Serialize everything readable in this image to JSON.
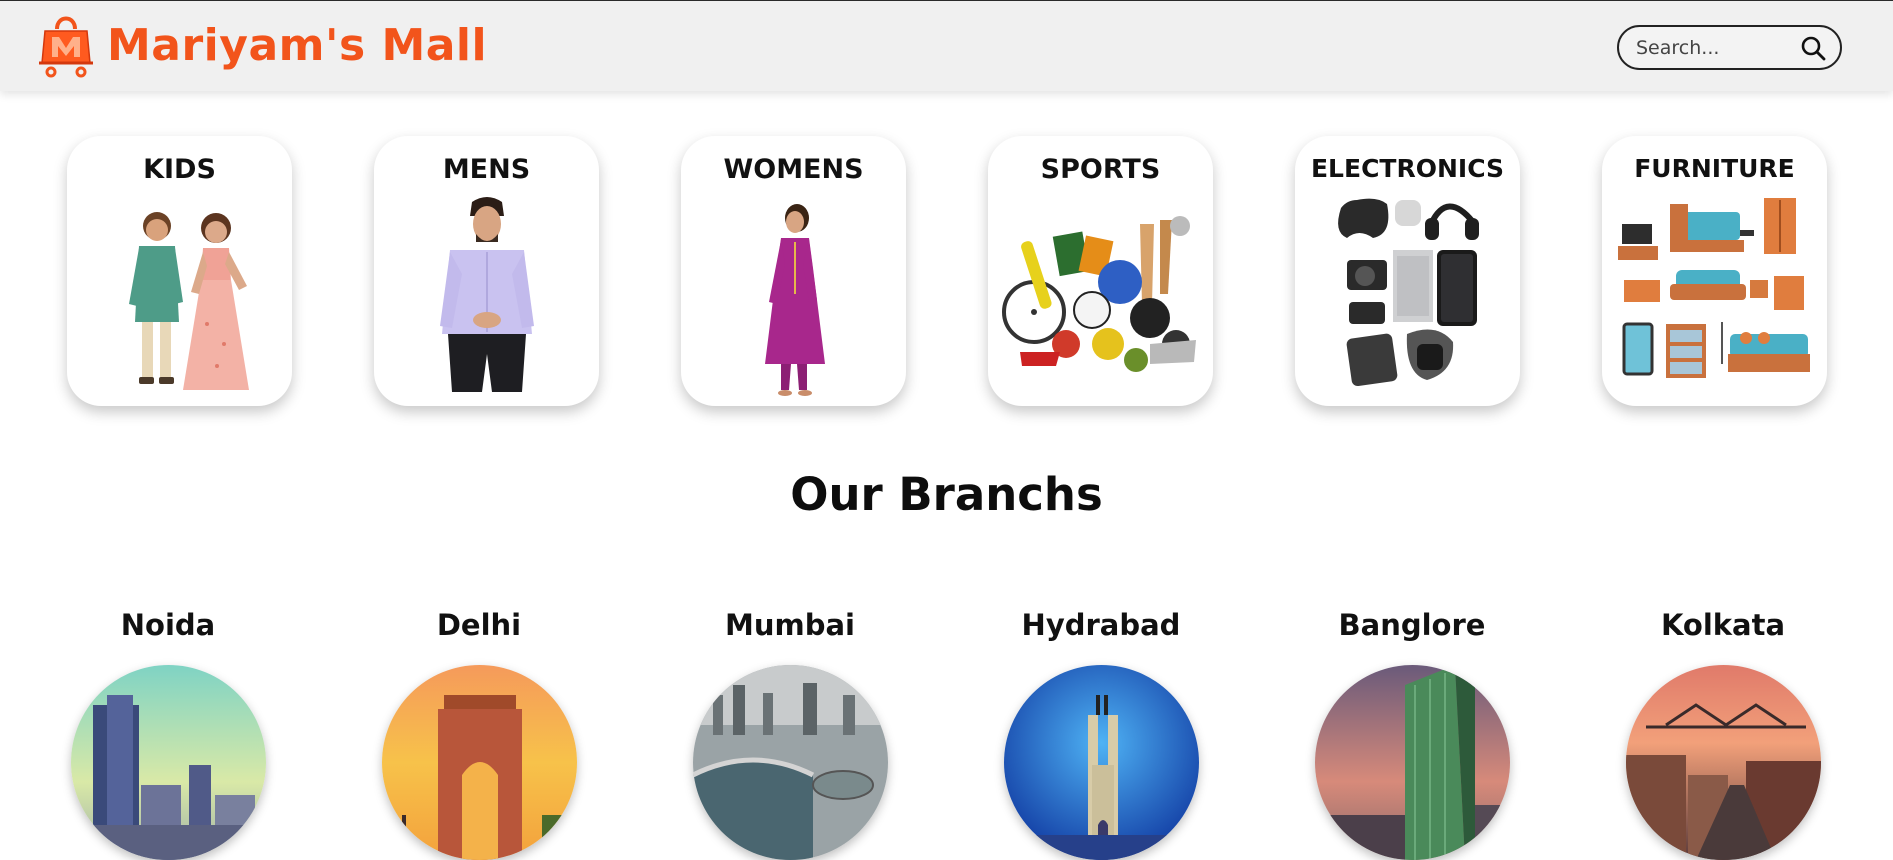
{
  "header": {
    "brand_name": "Mariyam's Mall",
    "brand_color": "#f2541b",
    "logo_icon": "shopping-bag-cart-logo",
    "search_placeholder": "Search...",
    "search_icon": "search-icon"
  },
  "categories": [
    {
      "label": "KIDS",
      "art": "kids-icon"
    },
    {
      "label": "MENS",
      "art": "men-shirt-icon"
    },
    {
      "label": "WOMENS",
      "art": "women-kurta-icon"
    },
    {
      "label": "SPORTS",
      "art": "sports-equipment-icon"
    },
    {
      "label": "ELECTRONICS",
      "art": "electronics-gadgets-icon"
    },
    {
      "label": "FURNITURE",
      "art": "furniture-set-icon"
    }
  ],
  "branches": {
    "title": "Our Branchs",
    "items": [
      {
        "name": "Noida",
        "photo": "noida-skyline-photo"
      },
      {
        "name": "Delhi",
        "photo": "delhi-india-gate-photo"
      },
      {
        "name": "Mumbai",
        "photo": "mumbai-marine-drive-photo"
      },
      {
        "name": "Hydrabad",
        "photo": "hyderabad-charminar-photo"
      },
      {
        "name": "Banglore",
        "photo": "bangalore-skyscraper-photo"
      },
      {
        "name": "Kolkata",
        "photo": "kolkata-howrah-bridge-photo"
      }
    ]
  }
}
